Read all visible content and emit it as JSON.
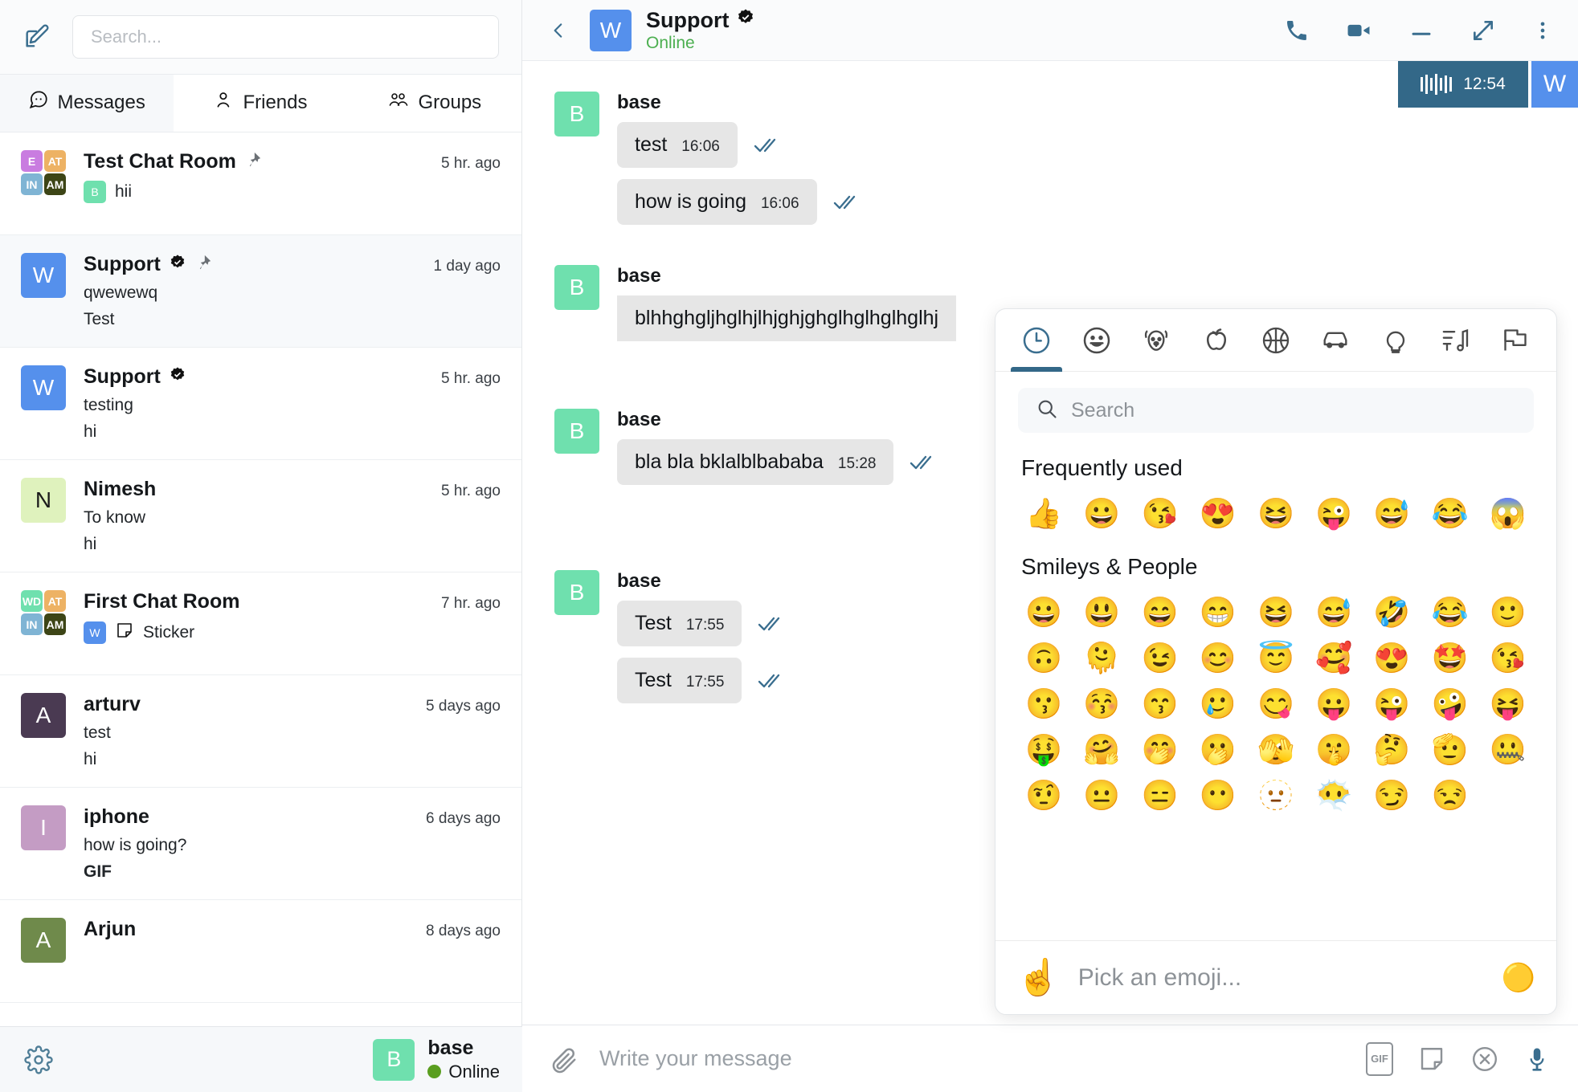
{
  "sidebar": {
    "compose_icon": "compose-edit-icon",
    "search": {
      "placeholder": "Search...",
      "value": ""
    },
    "tabs": [
      {
        "label": "Messages",
        "icon": "chat-bubble-icon",
        "active": true
      },
      {
        "label": "Friends",
        "icon": "person-icon",
        "active": false
      },
      {
        "label": "Groups",
        "icon": "people-group-icon",
        "active": false
      }
    ],
    "chats": [
      {
        "name": "Test Chat Room",
        "pinned": true,
        "verified": false,
        "time": "5 hr. ago",
        "avatar_type": "grid",
        "avatar_tiles": [
          {
            "label": "E",
            "color": "#c97ce0"
          },
          {
            "label": "AT",
            "color": "#edb264"
          },
          {
            "label": "IN",
            "color": "#7fb4d4"
          },
          {
            "label": "AM",
            "color": "#3d4516"
          }
        ],
        "preview_sender": {
          "label": "B",
          "color": "#6fe0ae",
          "online": true
        },
        "preview": "hii",
        "preview2": "",
        "selected": false
      },
      {
        "name": "Support",
        "pinned": true,
        "verified": true,
        "time": "1 day ago",
        "avatar_type": "single",
        "avatar_label": "W",
        "avatar_color": "#5590ec",
        "online": true,
        "preview": "qwewewq",
        "preview2": "Test",
        "selected": true
      },
      {
        "name": "Support",
        "pinned": false,
        "verified": true,
        "time": "5 hr. ago",
        "avatar_type": "single",
        "avatar_label": "W",
        "avatar_color": "#5590ec",
        "online": true,
        "preview": "testing",
        "preview2": "hi",
        "selected": false
      },
      {
        "name": "Nimesh",
        "pinned": false,
        "verified": false,
        "time": "5 hr. ago",
        "avatar_type": "single",
        "avatar_label": "N",
        "avatar_color": "#dff2bd",
        "avatar_text_color": "#1b1b1b",
        "online": false,
        "preview": "To know",
        "preview2": "hi",
        "selected": false
      },
      {
        "name": "First Chat Room",
        "pinned": false,
        "verified": false,
        "time": "7 hr. ago",
        "avatar_type": "grid",
        "avatar_tiles": [
          {
            "label": "WD",
            "color": "#6fe0ae"
          },
          {
            "label": "AT",
            "color": "#edb264"
          },
          {
            "label": "IN",
            "color": "#7fb4d4"
          },
          {
            "label": "AM",
            "color": "#3d4516"
          }
        ],
        "preview_sender": {
          "label": "W",
          "color": "#5590ec",
          "online": true
        },
        "preview_icon": "sticker-icon",
        "preview": "Sticker",
        "preview2": "",
        "selected": false
      },
      {
        "name": "arturv",
        "pinned": false,
        "verified": false,
        "time": "5 days ago",
        "avatar_type": "single",
        "avatar_label": "A",
        "avatar_color": "#4a3a52",
        "online": false,
        "preview": "test",
        "preview2": "hi",
        "selected": false
      },
      {
        "name": "iphone",
        "pinned": false,
        "verified": false,
        "time": "6 days ago",
        "avatar_type": "single",
        "avatar_label": "I",
        "avatar_color": "#c49cc4",
        "online": false,
        "preview": "how is going?",
        "preview2": "GIF",
        "selected": false
      },
      {
        "name": "Arjun",
        "pinned": false,
        "verified": false,
        "time": "8 days ago",
        "avatar_type": "single",
        "avatar_label": "A",
        "avatar_color": "#6f8a4b",
        "online": false,
        "preview": "",
        "preview2": "",
        "selected": false
      }
    ],
    "footer": {
      "settings_icon": "gear-icon",
      "me_name": "base",
      "me_status": "Online",
      "me_avatar_label": "B",
      "me_avatar_color": "#6fe0ae"
    }
  },
  "chat_header": {
    "back_icon": "chevron-left-icon",
    "avatar_label": "W",
    "avatar_color": "#5590ec",
    "title": "Support",
    "verified": true,
    "status": "Online",
    "actions": [
      {
        "icon": "phone-icon",
        "name": "audio-call-button"
      },
      {
        "icon": "video-icon",
        "name": "video-call-button"
      },
      {
        "icon": "minimize-icon",
        "name": "minimize-button"
      },
      {
        "icon": "expand-icon",
        "name": "expand-button"
      },
      {
        "icon": "more-vertical-icon",
        "name": "more-options-button"
      }
    ]
  },
  "call_widget": {
    "duration": "12:54",
    "participant_label": "W",
    "participant_color": "#5590ec",
    "bar_count": 7,
    "background": "#336888"
  },
  "messages": [
    {
      "author": "base",
      "avatar_label": "B",
      "avatar_color": "#6fe0ae",
      "bubbles": [
        {
          "text": "test",
          "time": "16:06",
          "status": "read"
        },
        {
          "text": "how is going",
          "time": "16:06",
          "status": "read"
        }
      ]
    },
    {
      "author": "base",
      "avatar_label": "B",
      "avatar_color": "#6fe0ae",
      "bubbles": [
        {
          "text": "blhhghgljhglhjlhjghjghglhglhglhglhj",
          "time": "",
          "status": ""
        }
      ]
    },
    {
      "author": "base",
      "avatar_label": "B",
      "avatar_color": "#6fe0ae",
      "bubbles": [
        {
          "text": "bla bla bklalblbababa",
          "time": "15:28",
          "status": "read"
        }
      ]
    },
    {
      "author": "base",
      "avatar_label": "B",
      "avatar_color": "#6fe0ae",
      "bubbles": [
        {
          "text": "Test",
          "time": "17:55",
          "status": "read"
        },
        {
          "text": "Test",
          "time": "17:55",
          "status": "read"
        }
      ]
    }
  ],
  "emoji_picker": {
    "tabs": [
      {
        "icon": "clock-icon",
        "name": "recent",
        "active": true
      },
      {
        "icon": "smiley-icon",
        "name": "smileys-people",
        "active": false
      },
      {
        "icon": "dog-icon",
        "name": "animals-nature",
        "active": false
      },
      {
        "icon": "apple-icon",
        "name": "food-drink",
        "active": false
      },
      {
        "icon": "basketball-icon",
        "name": "activity",
        "active": false
      },
      {
        "icon": "car-icon",
        "name": "travel-places",
        "active": false
      },
      {
        "icon": "lightbulb-icon",
        "name": "objects",
        "active": false
      },
      {
        "icon": "symbols-icon",
        "name": "symbols",
        "active": false
      },
      {
        "icon": "flag-icon",
        "name": "flags",
        "active": false
      }
    ],
    "search": {
      "placeholder": "Search",
      "value": ""
    },
    "sections": [
      {
        "title": "Frequently used",
        "emojis": [
          "👍",
          "😀",
          "😘",
          "😍",
          "😆",
          "😜",
          "😅",
          "😂",
          "😱"
        ]
      },
      {
        "title": "Smileys & People",
        "emojis": [
          "😀",
          "😃",
          "😄",
          "😁",
          "😆",
          "😅",
          "🤣",
          "😂",
          "🙂",
          "🙃",
          "🫠",
          "😉",
          "😊",
          "😇",
          "🥰",
          "😍",
          "🤩",
          "😘",
          "😗",
          "😚",
          "😙",
          "🥲",
          "😋",
          "😛",
          "😜",
          "🤪",
          "😝",
          "🤑",
          "🤗",
          "🤭",
          "🫢",
          "🫣",
          "🤫",
          "🤔",
          "🫡",
          "🤐",
          "🤨",
          "😐",
          "😑",
          "😶",
          "🫥",
          "😶‍🌫️",
          "😏",
          "😒"
        ]
      }
    ],
    "footer": {
      "preview_emoji": "☝️",
      "hint": "Pick an emoji...",
      "right_emoji": "🟡"
    }
  },
  "composer": {
    "attach_icon": "paperclip-icon",
    "placeholder": "Write your message",
    "value": "",
    "actions": [
      {
        "icon": "gif-icon",
        "label": "GIF",
        "name": "gif-button"
      },
      {
        "icon": "sticker-icon",
        "name": "sticker-button"
      },
      {
        "icon": "close-circle-icon",
        "name": "close-button"
      },
      {
        "icon": "microphone-icon",
        "name": "mic-button"
      }
    ]
  }
}
